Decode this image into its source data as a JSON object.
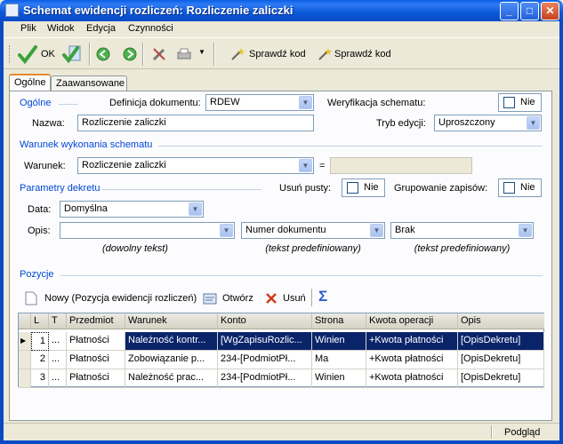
{
  "window": {
    "title": "Schemat ewidencji rozliczeń: Rozliczenie zaliczki"
  },
  "menu": [
    "Plik",
    "Widok",
    "Edycja",
    "Czynności"
  ],
  "toolbar": {
    "ok_label": "OK",
    "check_code_1": "Sprawdź kod",
    "check_code_2": "Sprawdź kod"
  },
  "tabs": [
    "Ogólne",
    "Zaawansowane"
  ],
  "general": {
    "section": "Ogólne",
    "doc_def_label": "Definicja dokumentu:",
    "doc_def_value": "RDEW",
    "verification_label": "Weryfikacja schematu:",
    "verification_value": "Nie",
    "name_label": "Nazwa:",
    "name_value": "Rozliczenie zaliczki",
    "edit_mode_label": "Tryb edycji:",
    "edit_mode_value": "Uproszczony"
  },
  "condition": {
    "section": "Warunek wykonania schematu",
    "label": "Warunek:",
    "value": "Rozliczenie zaliczki",
    "eq": "="
  },
  "decree": {
    "section": "Parametry dekretu",
    "remove_empty_label": "Usuń pusty:",
    "remove_empty_value": "Nie",
    "group_label": "Grupowanie zapisów:",
    "group_value": "Nie",
    "date_label": "Data:",
    "date_value": "Domyślna",
    "desc_label": "Opis:",
    "desc1_value": "",
    "desc2_value": "Numer dokumentu",
    "desc3_value": "Brak",
    "hint1": "(dowolny tekst)",
    "hint2": "(tekst predefiniowany)",
    "hint3": "(tekst predefiniowany)"
  },
  "positions": {
    "section": "Pozycje",
    "new_label": "Nowy (Pozycja ewidencji rozliczeń)",
    "open_label": "Otwórz",
    "delete_label": "Usuń",
    "sigma": "Σ",
    "columns": [
      "L",
      "T",
      "Przedmiot",
      "Warunek",
      "Konto",
      "Strona",
      "Kwota operacji",
      "Opis"
    ],
    "rows": [
      [
        "1",
        "...",
        "Płatności",
        "Należność kontr...",
        "[WgZapisuRozlic...",
        "Winien",
        "+Kwota płatności",
        "[OpisDekretu]"
      ],
      [
        "2",
        "...",
        "Płatności",
        "Zobowiązanie p...",
        "234-[PodmiotPł...",
        "Ma",
        "+Kwota płatności",
        "[OpisDekretu]"
      ],
      [
        "3",
        "...",
        "Płatności",
        "Należność prac...",
        "234-[PodmiotPł...",
        "Winien",
        "+Kwota płatności",
        "[OpisDekretu]"
      ]
    ]
  },
  "status": {
    "mode": "Podgląd"
  },
  "colors": {
    "section": "#0046d5",
    "selection": "#0a246a",
    "titlebar": "#0a5ee6"
  }
}
